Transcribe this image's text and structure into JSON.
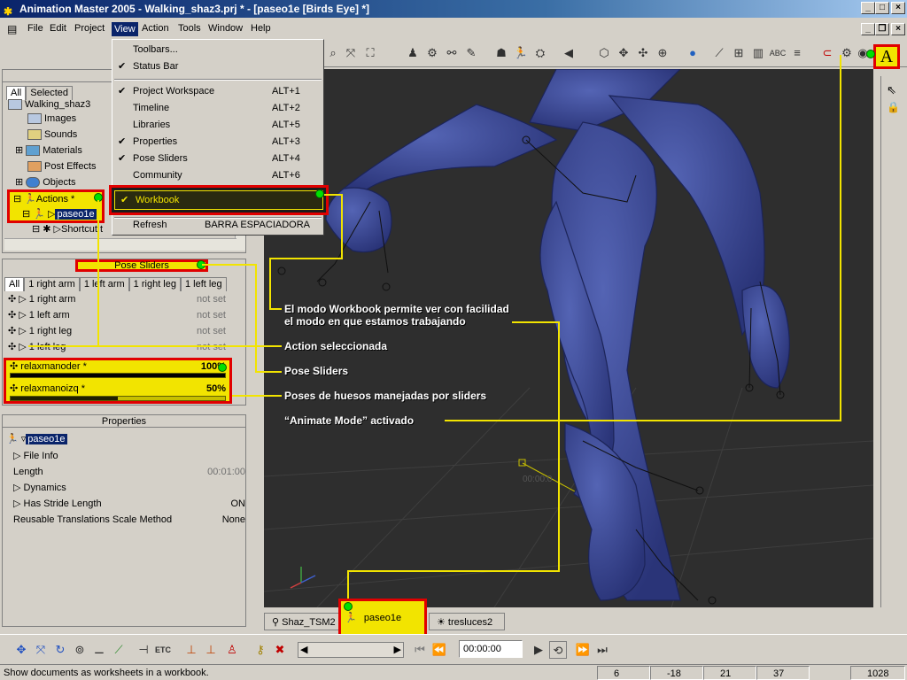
{
  "window": {
    "title": "Animation Master 2005 - Walking_shaz3.prj * - [paseo1e [Birds Eye] *]"
  },
  "menu": [
    "File",
    "Edit",
    "Project",
    "View",
    "Action",
    "Tools",
    "Window",
    "Help"
  ],
  "view_menu": [
    {
      "label": "Toolbars...",
      "shortcut": "",
      "checked": false
    },
    {
      "label": "Status Bar",
      "shortcut": "",
      "checked": true
    },
    {
      "label": "Project Workspace",
      "shortcut": "ALT+1",
      "checked": true
    },
    {
      "label": "Timeline",
      "shortcut": "ALT+2",
      "checked": false
    },
    {
      "label": "Libraries",
      "shortcut": "ALT+5",
      "checked": false
    },
    {
      "label": "Properties",
      "shortcut": "ALT+3",
      "checked": true
    },
    {
      "label": "Pose Sliders",
      "shortcut": "ALT+4",
      "checked": true
    },
    {
      "label": "Community",
      "shortcut": "ALT+6",
      "checked": false
    },
    {
      "label": "Workbook",
      "shortcut": "",
      "checked": true
    },
    {
      "label": "Refresh",
      "shortcut": "BARRA ESPACIADORA",
      "checked": false
    }
  ],
  "project_panel": {
    "title": "Projec",
    "tabs": [
      "All",
      "Selected"
    ],
    "items": [
      "Walking_shaz3",
      "Images",
      "Sounds",
      "Materials",
      "Post Effects",
      "Objects",
      "Actions *",
      "paseo1e",
      "Shortcut t"
    ]
  },
  "pose_panel": {
    "title": "Pose Sliders",
    "tabs": [
      "All",
      "1 right arm",
      "1 left arm",
      "1 right leg",
      "1 left leg"
    ],
    "groups": [
      {
        "label": "1 right arm",
        "value": "not set"
      },
      {
        "label": "1 left arm",
        "value": "not set"
      },
      {
        "label": "1 right leg",
        "value": "not set"
      },
      {
        "label": "1 left leg",
        "value": "not set"
      }
    ],
    "sliders": [
      {
        "label": "relaxmanoder *",
        "value": "100%",
        "level": 1.0
      },
      {
        "label": "relaxmanoizq *",
        "value": "50%",
        "level": 0.5
      }
    ]
  },
  "properties_panel": {
    "title": "Properties",
    "header": "paseo1e",
    "rows": [
      {
        "label": "File Info",
        "value": ""
      },
      {
        "label": "Length",
        "value": "00:01:00"
      },
      {
        "label": "Dynamics",
        "value": ""
      },
      {
        "label": "Has Stride Length",
        "value": "ON"
      },
      {
        "label": "Reusable Translations Scale Method",
        "value": "None"
      }
    ]
  },
  "viewport": {
    "time_label": "00:00:0"
  },
  "callouts": {
    "workbook": "El modo Workbook permite ver con facilidad",
    "workbook2": "el modo en que estamos trabajando",
    "action": "Action seleccionada",
    "pose": "Pose Sliders",
    "poses": "Poses de huesos manejadas por sliders",
    "animate": "“Animate Mode” activado"
  },
  "toolbar": {
    "animate_button": "A"
  },
  "bottom_tabs": [
    "Shaz_TSM2",
    "paseo1e",
    "tresluces2"
  ],
  "timecode": "00:00:00",
  "status": {
    "message": "Show documents as worksheets in a workbook.",
    "cells": [
      "6",
      "-18",
      "21",
      "37",
      "1028"
    ]
  },
  "colors": {
    "highlight": "#f2e400",
    "callout_box": "#e00000",
    "mesh": "#3c4a9a"
  }
}
